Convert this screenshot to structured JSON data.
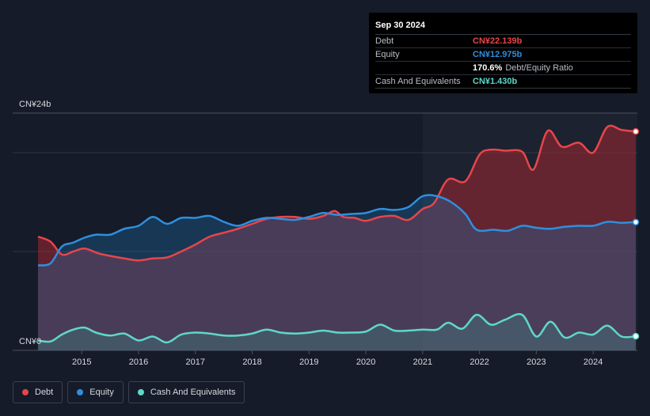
{
  "colors": {
    "debt": "#e8454a",
    "equity": "#2e8fde",
    "cash": "#5ed8c8"
  },
  "tooltip": {
    "date": "Sep 30 2024",
    "rows": [
      {
        "label": "Debt",
        "value": "CN¥22.139b"
      },
      {
        "label": "Equity",
        "value": "CN¥12.975b"
      },
      {
        "label": "",
        "value": "170.6%",
        "suffix": "Debt/Equity Ratio"
      },
      {
        "label": "Cash And Equivalents",
        "value": "CN¥1.430b"
      }
    ]
  },
  "legend": [
    {
      "label": "Debt"
    },
    {
      "label": "Equity"
    },
    {
      "label": "Cash And Equivalents"
    }
  ],
  "chart_data": {
    "type": "area",
    "ylabel_top": "CN¥24b",
    "ylabel_bottom": "CN¥0",
    "ylim": [
      0,
      24
    ],
    "xlim": [
      2014.23,
      2024.75
    ],
    "x_ticks": [
      "2015",
      "2016",
      "2017",
      "2018",
      "2019",
      "2020",
      "2021",
      "2022",
      "2023",
      "2024"
    ],
    "x_tick_values": [
      2015,
      2016,
      2017,
      2018,
      2019,
      2020,
      2021,
      2022,
      2023,
      2024
    ],
    "grid": true,
    "legend_position": "bottom-left",
    "series": [
      {
        "name": "Debt",
        "points": [
          [
            2014.23,
            11.5
          ],
          [
            2014.45,
            11.0
          ],
          [
            2014.65,
            9.7
          ],
          [
            2014.85,
            10.0
          ],
          [
            2015.05,
            10.3
          ],
          [
            2015.3,
            9.8
          ],
          [
            2015.55,
            9.5
          ],
          [
            2015.75,
            9.3
          ],
          [
            2016.0,
            9.1
          ],
          [
            2016.25,
            9.3
          ],
          [
            2016.5,
            9.4
          ],
          [
            2016.75,
            10.0
          ],
          [
            2017.0,
            10.7
          ],
          [
            2017.25,
            11.5
          ],
          [
            2017.5,
            11.9
          ],
          [
            2017.75,
            12.3
          ],
          [
            2018.0,
            12.8
          ],
          [
            2018.25,
            13.3
          ],
          [
            2018.5,
            13.5
          ],
          [
            2018.75,
            13.5
          ],
          [
            2019.0,
            13.3
          ],
          [
            2019.25,
            13.6
          ],
          [
            2019.45,
            14.1
          ],
          [
            2019.6,
            13.5
          ],
          [
            2019.8,
            13.4
          ],
          [
            2020.0,
            13.1
          ],
          [
            2020.25,
            13.5
          ],
          [
            2020.5,
            13.6
          ],
          [
            2020.75,
            13.2
          ],
          [
            2021.0,
            14.3
          ],
          [
            2021.2,
            14.9
          ],
          [
            2021.45,
            17.3
          ],
          [
            2021.75,
            17.1
          ],
          [
            2022.0,
            19.8
          ],
          [
            2022.2,
            20.3
          ],
          [
            2022.45,
            20.2
          ],
          [
            2022.75,
            20.1
          ],
          [
            2022.95,
            18.3
          ],
          [
            2023.2,
            22.2
          ],
          [
            2023.45,
            20.6
          ],
          [
            2023.75,
            21.0
          ],
          [
            2024.0,
            20.0
          ],
          [
            2024.25,
            22.6
          ],
          [
            2024.5,
            22.3
          ],
          [
            2024.75,
            22.14
          ]
        ]
      },
      {
        "name": "Equity",
        "points": [
          [
            2014.23,
            8.6
          ],
          [
            2014.45,
            8.8
          ],
          [
            2014.65,
            10.5
          ],
          [
            2014.85,
            10.9
          ],
          [
            2015.05,
            11.4
          ],
          [
            2015.25,
            11.7
          ],
          [
            2015.5,
            11.7
          ],
          [
            2015.75,
            12.3
          ],
          [
            2016.0,
            12.6
          ],
          [
            2016.25,
            13.5
          ],
          [
            2016.5,
            12.8
          ],
          [
            2016.75,
            13.4
          ],
          [
            2017.0,
            13.4
          ],
          [
            2017.25,
            13.6
          ],
          [
            2017.5,
            13.0
          ],
          [
            2017.75,
            12.6
          ],
          [
            2018.0,
            13.1
          ],
          [
            2018.25,
            13.4
          ],
          [
            2018.5,
            13.3
          ],
          [
            2018.75,
            13.2
          ],
          [
            2019.0,
            13.5
          ],
          [
            2019.25,
            13.9
          ],
          [
            2019.5,
            13.7
          ],
          [
            2019.75,
            13.8
          ],
          [
            2020.0,
            13.9
          ],
          [
            2020.25,
            14.3
          ],
          [
            2020.5,
            14.2
          ],
          [
            2020.75,
            14.5
          ],
          [
            2021.0,
            15.6
          ],
          [
            2021.25,
            15.6
          ],
          [
            2021.5,
            15.0
          ],
          [
            2021.75,
            13.8
          ],
          [
            2021.95,
            12.2
          ],
          [
            2022.25,
            12.2
          ],
          [
            2022.5,
            12.1
          ],
          [
            2022.75,
            12.6
          ],
          [
            2023.0,
            12.4
          ],
          [
            2023.25,
            12.3
          ],
          [
            2023.5,
            12.5
          ],
          [
            2023.75,
            12.6
          ],
          [
            2024.0,
            12.6
          ],
          [
            2024.25,
            13.0
          ],
          [
            2024.5,
            12.9
          ],
          [
            2024.75,
            12.975
          ]
        ]
      },
      {
        "name": "Cash And Equivalents",
        "points": [
          [
            2014.23,
            1.0
          ],
          [
            2014.45,
            0.9
          ],
          [
            2014.65,
            1.6
          ],
          [
            2014.85,
            2.1
          ],
          [
            2015.05,
            2.3
          ],
          [
            2015.25,
            1.8
          ],
          [
            2015.5,
            1.5
          ],
          [
            2015.75,
            1.7
          ],
          [
            2016.0,
            1.0
          ],
          [
            2016.25,
            1.4
          ],
          [
            2016.5,
            0.8
          ],
          [
            2016.75,
            1.6
          ],
          [
            2017.0,
            1.8
          ],
          [
            2017.25,
            1.7
          ],
          [
            2017.5,
            1.5
          ],
          [
            2017.75,
            1.5
          ],
          [
            2018.0,
            1.7
          ],
          [
            2018.25,
            2.1
          ],
          [
            2018.5,
            1.8
          ],
          [
            2018.75,
            1.7
          ],
          [
            2019.0,
            1.8
          ],
          [
            2019.25,
            2.0
          ],
          [
            2019.5,
            1.8
          ],
          [
            2019.75,
            1.8
          ],
          [
            2020.0,
            1.9
          ],
          [
            2020.25,
            2.6
          ],
          [
            2020.5,
            2.0
          ],
          [
            2020.75,
            2.0
          ],
          [
            2021.0,
            2.1
          ],
          [
            2021.25,
            2.1
          ],
          [
            2021.45,
            2.8
          ],
          [
            2021.7,
            2.2
          ],
          [
            2021.95,
            3.6
          ],
          [
            2022.2,
            2.6
          ],
          [
            2022.45,
            3.1
          ],
          [
            2022.75,
            3.6
          ],
          [
            2023.0,
            1.4
          ],
          [
            2023.25,
            2.9
          ],
          [
            2023.5,
            1.3
          ],
          [
            2023.75,
            1.8
          ],
          [
            2024.0,
            1.6
          ],
          [
            2024.25,
            2.5
          ],
          [
            2024.5,
            1.4
          ],
          [
            2024.75,
            1.43
          ]
        ]
      }
    ]
  }
}
